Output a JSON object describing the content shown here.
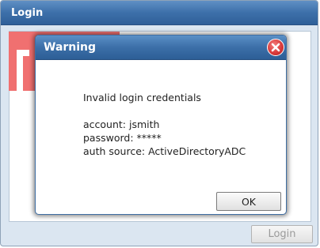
{
  "login_window": {
    "title": "Login",
    "login_button_label": "Login"
  },
  "dialog": {
    "title": "Warning",
    "message": {
      "heading": "Invalid login credentials",
      "account": "account: jsmith",
      "password": "password: *****",
      "auth_source": "auth source: ActiveDirectoryADC"
    },
    "ok_label": "OK",
    "close_icon": "close-icon"
  },
  "colors": {
    "titlebar": "#3d70aa",
    "logo_red": "#f07070",
    "close_red": "#d93b3b"
  }
}
